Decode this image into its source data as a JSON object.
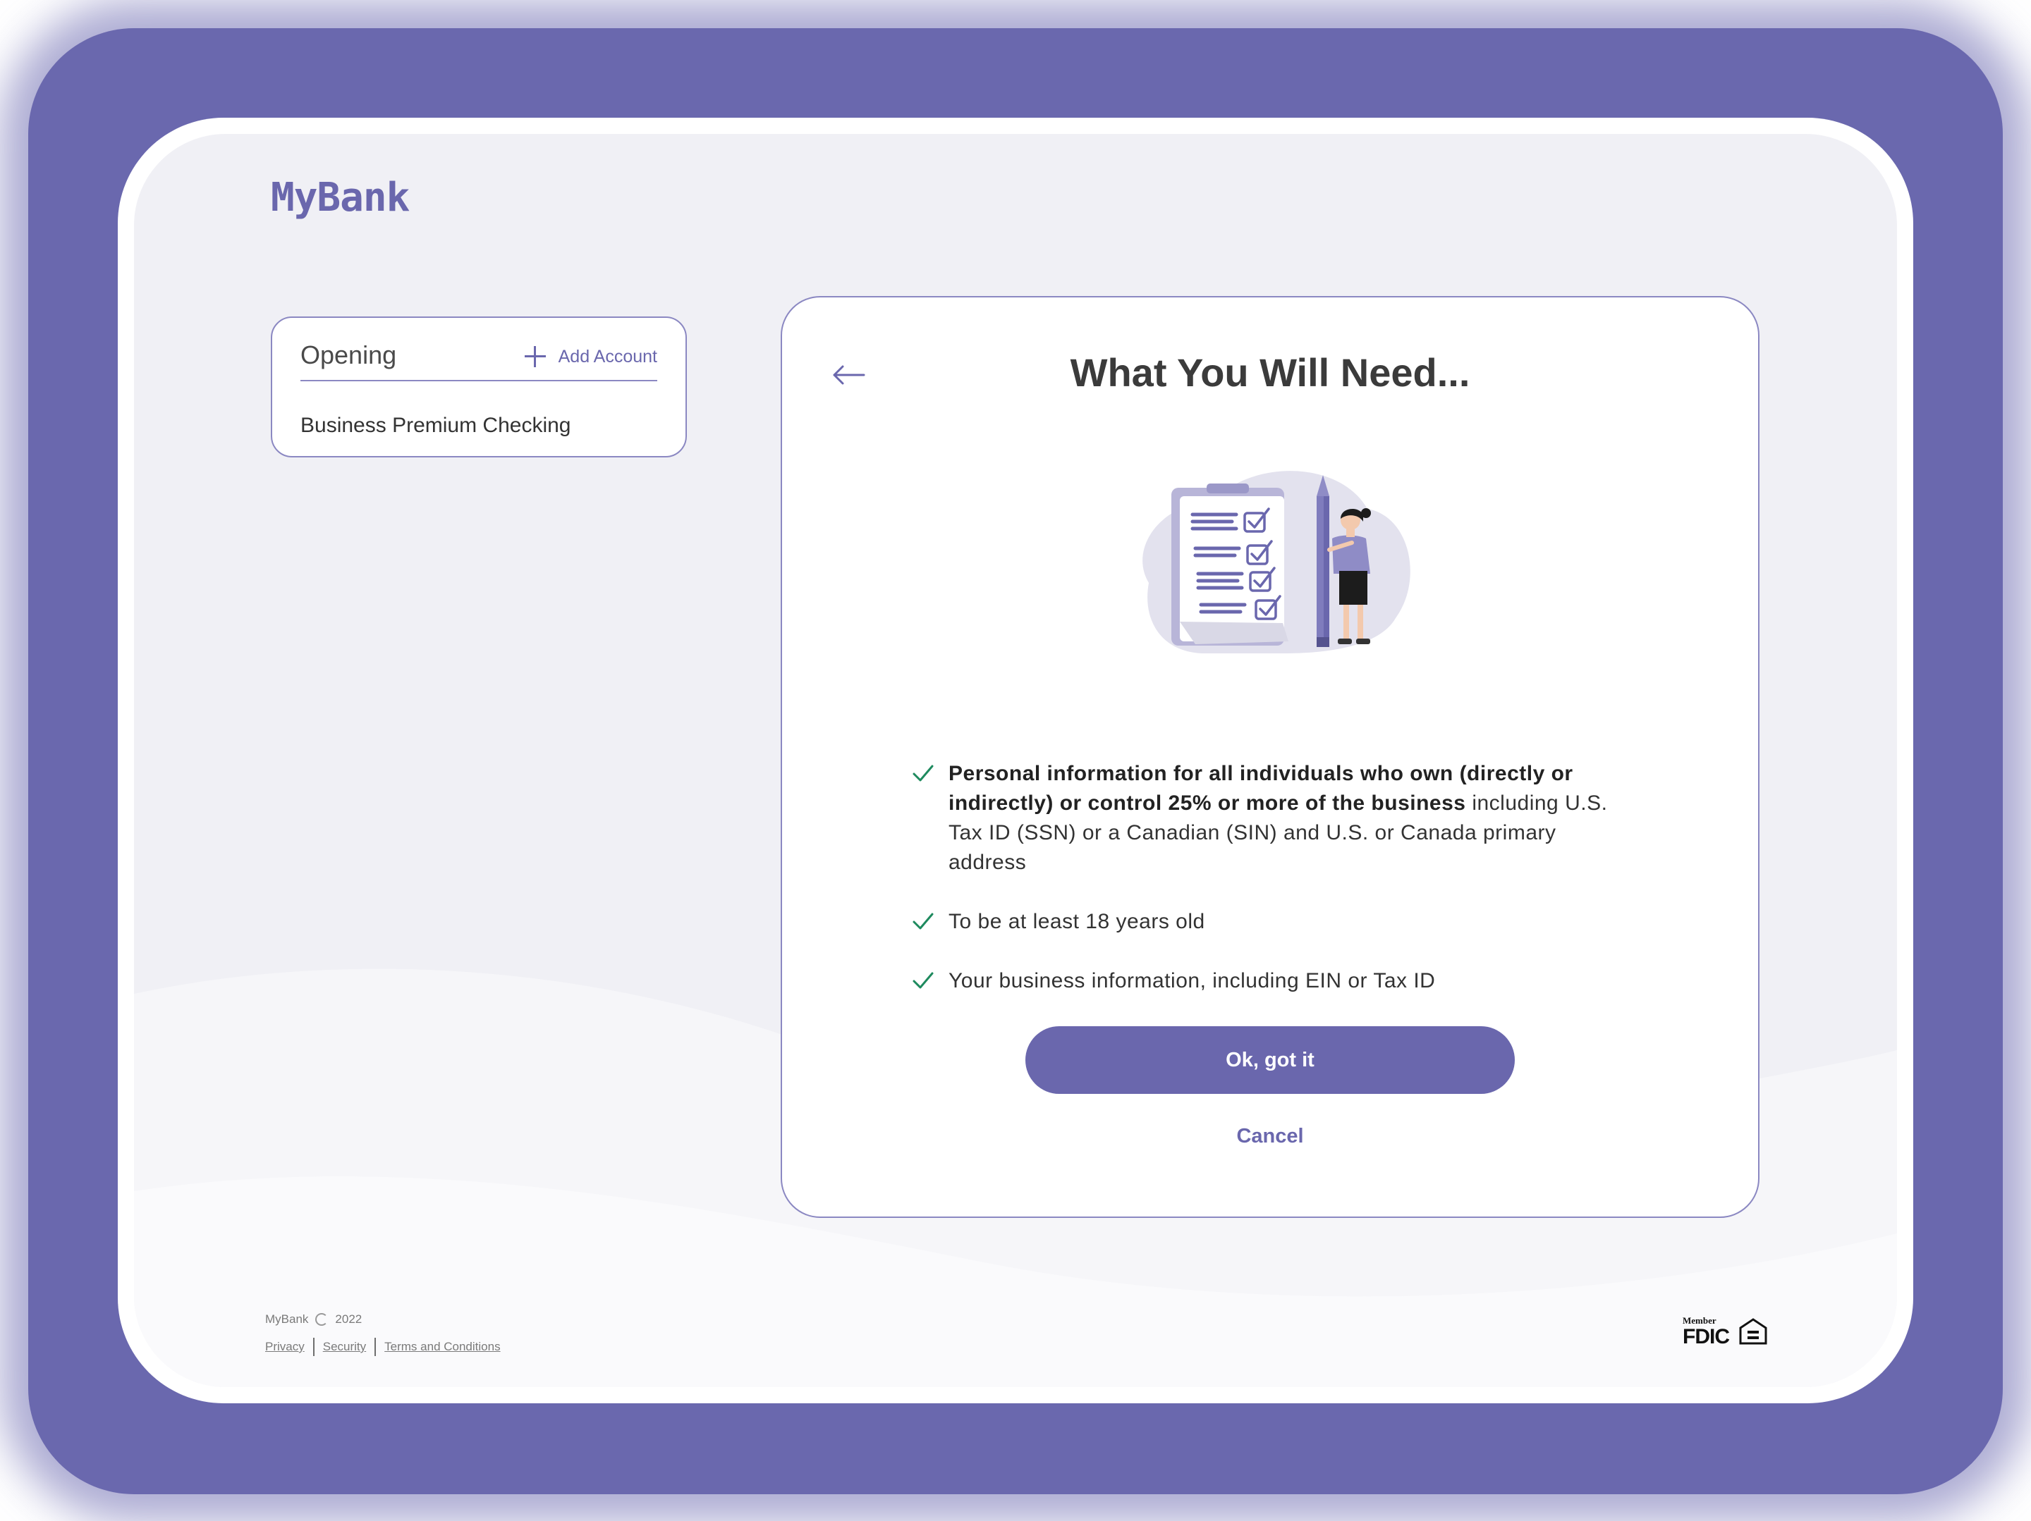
{
  "app": {
    "logo": "MyBank"
  },
  "accounts_panel": {
    "title": "Opening",
    "add_label": "Add Account",
    "items": [
      "Business Premium Checking"
    ]
  },
  "modal": {
    "title": "What You Will Need...",
    "requirements": [
      {
        "bold": "Personal information for all individuals who own (directly or indirectly) or control 25% or more of the business",
        "text": " including U.S. Tax ID (SSN) or a Canadian (SIN) and U.S. or Canada primary address"
      },
      {
        "bold": "",
        "text": "To be at least 18 years old"
      },
      {
        "bold": "",
        "text": "Your business information, including EIN or Tax ID"
      }
    ],
    "primary_button": "Ok, got it",
    "secondary_button": "Cancel"
  },
  "footer": {
    "brand": "MyBank",
    "year": "2022",
    "links": [
      "Privacy",
      "Security",
      "Terms and Conditions"
    ],
    "fdic_member": "Member",
    "fdic": "FDIC"
  },
  "colors": {
    "accent": "#6a67ad",
    "check": "#1e8a5e",
    "backdrop": "#6a68ae",
    "screen_bg": "#f0f0f5"
  }
}
